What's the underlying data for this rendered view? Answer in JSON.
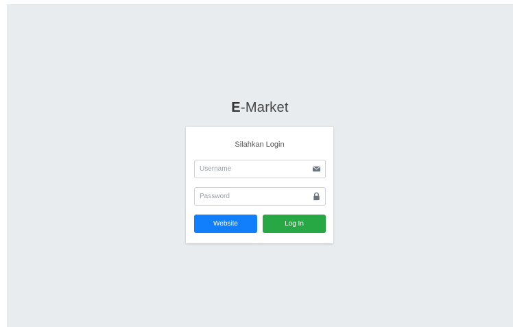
{
  "app": {
    "logo_prefix": "E",
    "logo_suffix": "-Market"
  },
  "login_card": {
    "message": "Silahkan Login",
    "username": {
      "placeholder": "Username",
      "value": "",
      "icon": "envelope-icon"
    },
    "password": {
      "placeholder": "Password",
      "value": "",
      "icon": "lock-icon"
    },
    "website_button": {
      "label": "Website",
      "color": "#117efc"
    },
    "login_button": {
      "label": "Log In",
      "color": "#28a745"
    }
  },
  "colors": {
    "background": "#e9ecef",
    "card": "#ffffff"
  }
}
